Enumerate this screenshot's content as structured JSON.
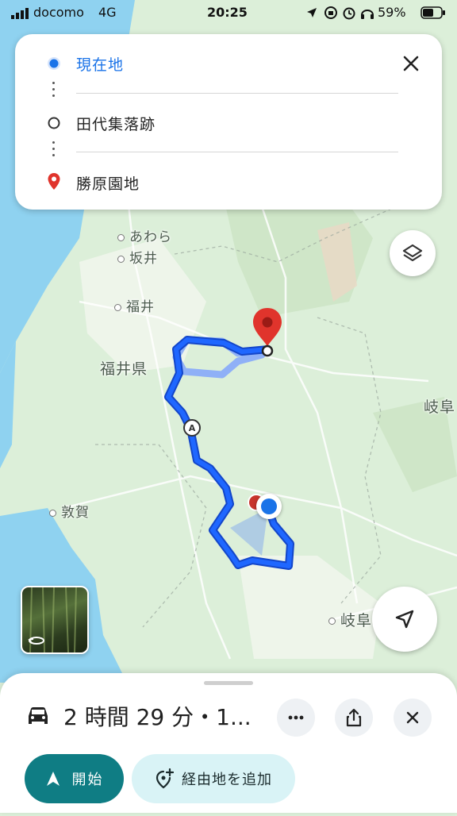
{
  "status_bar": {
    "carrier": "docomo",
    "network": "4G",
    "time": "20:25",
    "battery": "59%"
  },
  "directions": {
    "origin": "現在地",
    "waypoint": "田代集落跡",
    "destination": "勝原園地"
  },
  "map": {
    "labels": {
      "awara": "あわら",
      "sakai": "坂井",
      "fukui_city": "福井",
      "fukui_pref": "福井県",
      "tsuruga": "敦賀",
      "gifu_pref": "岐阜",
      "gifu_city": "岐阜"
    },
    "route_marker": "A",
    "colors": {
      "water": "#8fd2f0",
      "land": "#dcefd9",
      "route": "#1a5cf0",
      "route_alt": "#8fb0f7",
      "destination_pin": "#e0342c"
    }
  },
  "bottom_sheet": {
    "summary": "2 時間 29 分・1...",
    "start_label": "開始",
    "add_stop_label": "経由地を追加"
  },
  "icons": {
    "car": "car-icon",
    "more": "more-horizontal-icon",
    "share": "share-icon",
    "close": "close-icon",
    "layers": "layers-icon",
    "locate": "navigation-arrow-icon",
    "rotate": "rotate-360-icon"
  }
}
